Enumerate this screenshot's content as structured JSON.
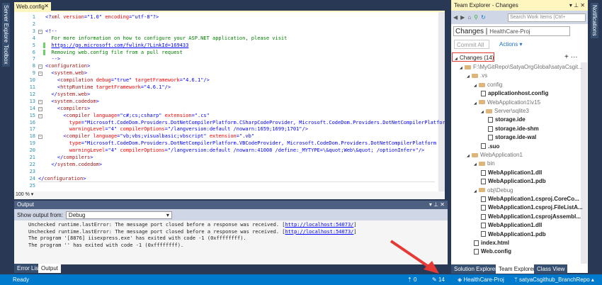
{
  "sidebar_left": [
    "Server Explorer",
    "Toolbox"
  ],
  "sidebar_right": [
    "Notifications"
  ],
  "editor": {
    "tab": "Web.config",
    "zoom": "100 %",
    "lines": [
      [
        [
          "b",
          "<?"
        ],
        [
          "n",
          "xml"
        ],
        [
          "a",
          " version"
        ],
        [
          "b",
          "=\""
        ],
        [
          "v",
          "1.0"
        ],
        [
          "b",
          "\""
        ],
        [
          "a",
          " encoding"
        ],
        [
          "b",
          "=\""
        ],
        [
          "v",
          "utf-8"
        ],
        [
          "b",
          "\"?>"
        ]
      ],
      [],
      [
        [
          "b",
          "<!--"
        ]
      ],
      [
        [
          "c",
          "  For more information on how to configure your ASP.NET application, please visit"
        ]
      ],
      [
        [
          "p",
          "  "
        ],
        [
          "u",
          "https://go.microsoft.com/fwlink/?LinkId=169433"
        ]
      ],
      [
        [
          "c",
          "  Removing web.config file from a pull request"
        ]
      ],
      [
        [
          "c",
          "  "
        ],
        [
          "b",
          "-->"
        ]
      ],
      [
        [
          "b",
          "<"
        ],
        [
          "n",
          "configuration"
        ],
        [
          "b",
          ">"
        ]
      ],
      [
        [
          "b",
          "  <"
        ],
        [
          "n",
          "system.web"
        ],
        [
          "b",
          ">"
        ]
      ],
      [
        [
          "b",
          "    <"
        ],
        [
          "n",
          "compilation"
        ],
        [
          "a",
          " debug"
        ],
        [
          "b",
          "=\""
        ],
        [
          "v",
          "true"
        ],
        [
          "b",
          "\""
        ],
        [
          "a",
          " targetFramework"
        ],
        [
          "b",
          "=\""
        ],
        [
          "v",
          "4.6.1"
        ],
        [
          "b",
          "\"/>"
        ]
      ],
      [
        [
          "b",
          "    <"
        ],
        [
          "n",
          "httpRuntime"
        ],
        [
          "a",
          " targetFramework"
        ],
        [
          "b",
          "=\""
        ],
        [
          "v",
          "4.6.1"
        ],
        [
          "b",
          "\"/>"
        ]
      ],
      [
        [
          "b",
          "  </"
        ],
        [
          "n",
          "system.web"
        ],
        [
          "b",
          ">"
        ]
      ],
      [
        [
          "b",
          "  <"
        ],
        [
          "n",
          "system.codedom"
        ],
        [
          "b",
          ">"
        ]
      ],
      [
        [
          "b",
          "    <"
        ],
        [
          "n",
          "compilers"
        ],
        [
          "b",
          ">"
        ]
      ],
      [
        [
          "b",
          "      <"
        ],
        [
          "n",
          "compiler"
        ],
        [
          "a",
          " language"
        ],
        [
          "b",
          "=\""
        ],
        [
          "v",
          "c#;cs;csharp"
        ],
        [
          "b",
          "\""
        ],
        [
          "a",
          " extension"
        ],
        [
          "b",
          "=\""
        ],
        [
          "v",
          ".cs"
        ],
        [
          "b",
          "\""
        ]
      ],
      [
        [
          "a",
          "        type"
        ],
        [
          "b",
          "=\""
        ],
        [
          "v",
          "Microsoft.CodeDom.Providers.DotNetCompilerPlatform.CSharpCodeProvider, Microsoft.CodeDom.Providers.DotNetCompilerPlatform"
        ]
      ],
      [
        [
          "a",
          "        warningLevel"
        ],
        [
          "b",
          "=\""
        ],
        [
          "v",
          "4"
        ],
        [
          "b",
          "\""
        ],
        [
          "a",
          " compilerOptions"
        ],
        [
          "b",
          "=\""
        ],
        [
          "v",
          "/langversion:default /nowarn:1659;1699;1701"
        ],
        [
          "b",
          "\"/>"
        ]
      ],
      [
        [
          "b",
          "      <"
        ],
        [
          "n",
          "compiler"
        ],
        [
          "a",
          " language"
        ],
        [
          "b",
          "=\""
        ],
        [
          "v",
          "vb;vbs;visualbasic;vbscript"
        ],
        [
          "b",
          "\""
        ],
        [
          "a",
          " extension"
        ],
        [
          "b",
          "=\""
        ],
        [
          "v",
          ".vb"
        ],
        [
          "b",
          "\""
        ]
      ],
      [
        [
          "a",
          "        type"
        ],
        [
          "b",
          "=\""
        ],
        [
          "v",
          "Microsoft.CodeDom.Providers.DotNetCompilerPlatform.VBCodeProvider, Microsoft.CodeDom.Providers.DotNetCompilerPlatform"
        ]
      ],
      [
        [
          "a",
          "        warningLevel"
        ],
        [
          "b",
          "=\""
        ],
        [
          "v",
          "4"
        ],
        [
          "b",
          "\""
        ],
        [
          "a",
          " compilerOptions"
        ],
        [
          "b",
          "=\""
        ],
        [
          "v",
          "/langversion:default /nowarn:41008 /define:_MYTYPE=\\&quot;Web\\&quot; /optionInfer+"
        ],
        [
          "b",
          "\"/>"
        ]
      ],
      [
        [
          "b",
          "    </"
        ],
        [
          "n",
          "compilers"
        ],
        [
          "b",
          ">"
        ]
      ],
      [
        [
          "b",
          "  </"
        ],
        [
          "n",
          "system.codedom"
        ],
        [
          "b",
          ">"
        ]
      ],
      [],
      [
        [
          "b",
          "</"
        ],
        [
          "n",
          "configuration"
        ],
        [
          "b",
          ">"
        ]
      ],
      []
    ]
  },
  "output": {
    "title": "Output",
    "show_label": "Show output from:",
    "source": "Debug",
    "lines": [
      {
        "text": "Unchecked runtime.lastError: The message port closed before a response was received. [",
        "link": "http://localhost:54073/",
        "end": "]"
      },
      {
        "text": "Unchecked runtime.lastError: The message port closed before a response was received. [",
        "link": "http://localhost:54073/",
        "end": "]"
      },
      {
        "text": "The program '[8876] iisexpress.exe' has exited with code -1 (0xffffffff)."
      },
      {
        "text": "The program '' has exited with code -1 (0xffffffff)."
      }
    ],
    "tabs": [
      "Error List",
      "Output"
    ]
  },
  "team_explorer": {
    "title": "Team Explorer - Changes",
    "search_placeholder": "Search Work Items (Ctrl+",
    "page": "Changes",
    "project": "HealthCare-Proj",
    "commit_all": "Commit All",
    "actions": "Actions",
    "changes_header": "Changes (14)",
    "tree": [
      {
        "level": 0,
        "type": "folder",
        "label": "F:\\MyGitRepo\\SatyaOrgGlobal\\satyaCsgit..."
      },
      {
        "level": 1,
        "type": "folder",
        "label": ".vs"
      },
      {
        "level": 2,
        "type": "folder",
        "label": "config"
      },
      {
        "level": 3,
        "type": "file",
        "label": "applicationhost.config"
      },
      {
        "level": 2,
        "type": "folder",
        "label": "WebApplication1\\v15"
      },
      {
        "level": 3,
        "type": "folder",
        "label": "Server\\sqlite3"
      },
      {
        "level": 4,
        "type": "file",
        "label": "storage.ide"
      },
      {
        "level": 4,
        "type": "file",
        "label": "storage.ide-shm"
      },
      {
        "level": 4,
        "type": "file",
        "label": "storage.ide-wal"
      },
      {
        "level": 3,
        "type": "file",
        "label": ".suo"
      },
      {
        "level": 1,
        "type": "folder",
        "label": "WebApplication1"
      },
      {
        "level": 2,
        "type": "folder",
        "label": "bin"
      },
      {
        "level": 3,
        "type": "file",
        "label": "WebApplication1.dll"
      },
      {
        "level": 3,
        "type": "file",
        "label": "WebApplication1.pdb"
      },
      {
        "level": 2,
        "type": "folder",
        "label": "obj\\Debug"
      },
      {
        "level": 3,
        "type": "file",
        "label": "WebApplication1.csproj.CoreCo..."
      },
      {
        "level": 3,
        "type": "file",
        "label": "WebApplication1.csproj.FileListA..."
      },
      {
        "level": 3,
        "type": "file",
        "label": "WebApplication1.csprojAssembl..."
      },
      {
        "level": 3,
        "type": "file",
        "label": "WebApplication1.dll"
      },
      {
        "level": 3,
        "type": "file",
        "label": "WebApplication1.pdb"
      },
      {
        "level": 2,
        "type": "file",
        "label": "index.html"
      },
      {
        "level": 2,
        "type": "file",
        "label": "Web.config"
      }
    ],
    "tabs": [
      "Solution Explorer",
      "Team Explorer",
      "Class View"
    ]
  },
  "status": {
    "ready": "Ready",
    "up": "0",
    "pending": "14",
    "project": "HealthCare-Proj",
    "branch": "satyaCsgithub_BranchRepo"
  },
  "colors": {
    "status_bar": "#007acc",
    "highlight_box": "#e53935",
    "arrow": "#e53935"
  }
}
